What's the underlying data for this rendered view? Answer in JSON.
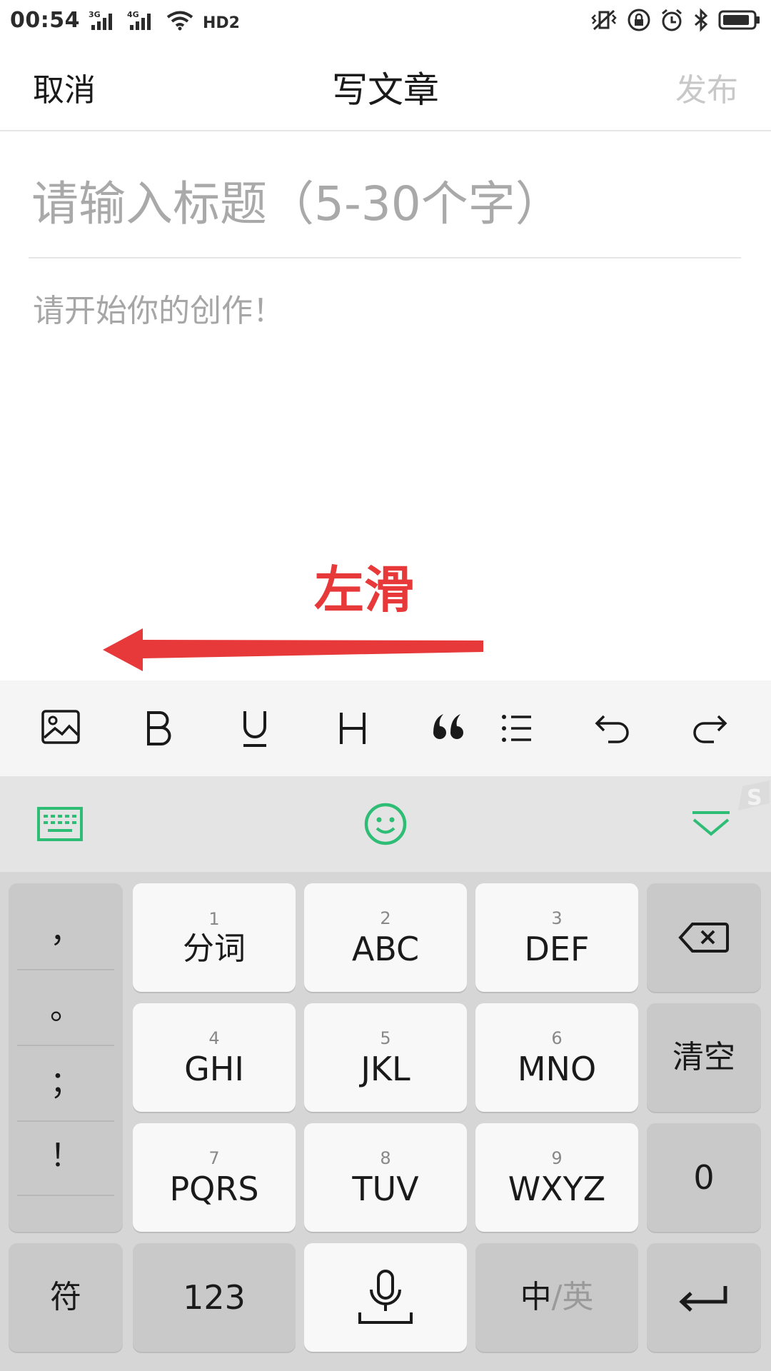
{
  "status_bar": {
    "time": "00:54",
    "net_3g": "3G",
    "net_4g": "4G",
    "hd": "HD2"
  },
  "header": {
    "cancel_label": "取消",
    "title": "写文章",
    "publish_label": "发布",
    "publish_color": "#c8c8c8"
  },
  "editor": {
    "title_placeholder": "请输入标题（5-30个字）",
    "title_value": "",
    "body_placeholder": "请开始你的创作！",
    "body_value": ""
  },
  "annotation": {
    "label": "左滑",
    "color": "#e8393a",
    "arrow_direction": "left"
  },
  "format_toolbar": {
    "items": [
      {
        "icon": "image-icon"
      },
      {
        "icon": "bold-icon",
        "glyph": "B"
      },
      {
        "icon": "underline-icon",
        "glyph": "U"
      },
      {
        "icon": "heading-icon",
        "glyph": "H"
      },
      {
        "icon": "quote-icon"
      },
      {
        "icon": "list-icon"
      },
      {
        "icon": "undo-icon"
      },
      {
        "icon": "redo-icon"
      }
    ]
  },
  "keyboard": {
    "accent_color": "#2dbd74",
    "top_bar": [
      {
        "icon": "keyboard-icon"
      },
      {
        "icon": "emoji-icon"
      },
      {
        "icon": "collapse-keyboard-icon"
      }
    ],
    "punctuation": [
      "，",
      "。",
      "；",
      "！"
    ],
    "keys": {
      "k1": {
        "num": "1",
        "label": "分词"
      },
      "k2": {
        "num": "2",
        "label": "ABC"
      },
      "k3": {
        "num": "3",
        "label": "DEF"
      },
      "k4": {
        "num": "4",
        "label": "GHI"
      },
      "k5": {
        "num": "5",
        "label": "JKL"
      },
      "k6": {
        "num": "6",
        "label": "MNO"
      },
      "k7": {
        "num": "7",
        "label": "PQRS"
      },
      "k8": {
        "num": "8",
        "label": "TUV"
      },
      "k9": {
        "num": "9",
        "label": "WXYZ"
      },
      "clear": "清空",
      "zero": "0",
      "symbols": "符",
      "num123": "123",
      "lang_cn": "中",
      "lang_sep": "/",
      "lang_en": "英"
    }
  }
}
